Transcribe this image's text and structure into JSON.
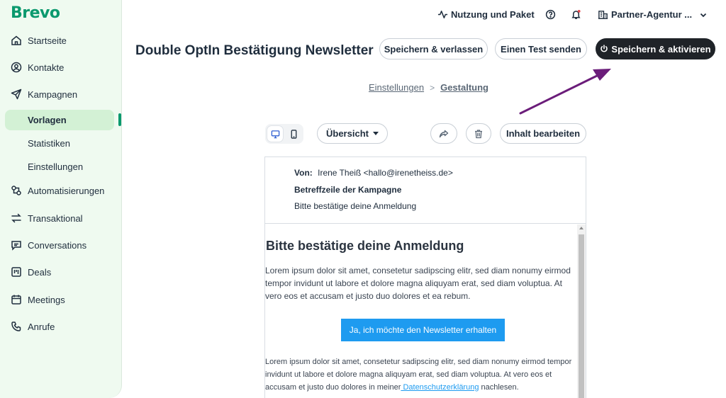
{
  "brand": {
    "logo_text": "Brevo",
    "accent": "#0b996e"
  },
  "sidebar": {
    "items": [
      {
        "label": "Startseite",
        "icon": "home-icon"
      },
      {
        "label": "Kontakte",
        "icon": "user-circle-icon"
      },
      {
        "label": "Kampagnen",
        "icon": "send-icon"
      },
      {
        "label": "Automatisierungen",
        "icon": "automation-icon"
      },
      {
        "label": "Transaktional",
        "icon": "arrows-exchange-icon"
      },
      {
        "label": "Conversations",
        "icon": "chat-icon"
      },
      {
        "label": "Deals",
        "icon": "kanban-icon"
      },
      {
        "label": "Meetings",
        "icon": "calendar-icon"
      },
      {
        "label": "Anrufe",
        "icon": "phone-icon"
      }
    ],
    "sub_items": {
      "active": "Vorlagen",
      "statistik": "Statistiken",
      "einstellungen": "Einstellungen"
    }
  },
  "topbar": {
    "usage_label": "Nutzung und Paket",
    "account_label": "Partner-Agentur ..."
  },
  "header": {
    "title": "Double OptIn Bestätigung Newsletter",
    "save_exit_label": "Speichern & verlassen",
    "send_test_label": "Einen Test senden",
    "save_activate_label": "Speichern & aktivieren"
  },
  "breadcrumb": {
    "step1": "Einstellungen",
    "step2": "Gestaltung"
  },
  "editor": {
    "view_select": "Übersicht",
    "edit_content_label": "Inhalt bearbeiten"
  },
  "email": {
    "from_label": "Von:",
    "from_value": "Irene Theiß <hallo@irenetheiss.de>",
    "subject_label": "Betreffzeile der Kampagne",
    "preview_text": "Bitte bestätige deine Anmeldung",
    "heading": "Bitte bestätige deine Anmeldung",
    "paragraph": "Lorem ipsum dolor sit amet, consetetur sadipscing elitr, sed diam nonumy eirmod tempor invidunt ut labore et dolore magna aliquyam erat, sed diam voluptua. At vero eos et accusam et justo duo dolores et ea rebum.",
    "cta_label": "Ja, ich möchte den Newsletter erhalten",
    "footer_text": "Lorem ipsum dolor sit amet, consetetur sadipscing elitr, sed diam nonumy eirmod tempor invidunt ut labore et dolore magna aliquyam erat, sed diam voluptua. At vero eos et accusam et justo duo dolores in meiner",
    "footer_link": " Datenschutzerklärung",
    "footer_tail": " nachlesen."
  },
  "annotation": {
    "arrow_color": "#6b1d7a"
  }
}
